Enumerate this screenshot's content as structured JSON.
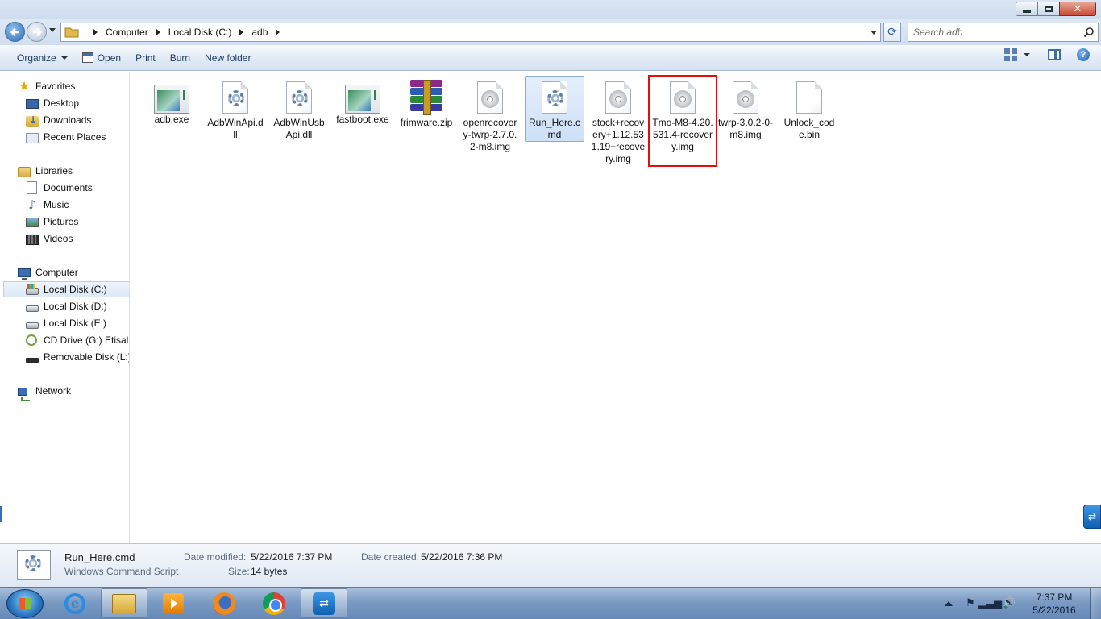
{
  "window": {
    "minimize": "minimize",
    "maximize": "maximize",
    "close": "close"
  },
  "address": {
    "crumbs": [
      "Computer",
      "Local Disk (C:)",
      "adb"
    ],
    "search_placeholder": "Search adb"
  },
  "commands": {
    "organize": "Organize",
    "open": "Open",
    "print": "Print",
    "burn": "Burn",
    "new_folder": "New folder"
  },
  "nav": {
    "favorites": "Favorites",
    "desktop": "Desktop",
    "downloads": "Downloads",
    "recent": "Recent Places",
    "libraries": "Libraries",
    "documents": "Documents",
    "music": "Music",
    "pictures": "Pictures",
    "videos": "Videos",
    "computer": "Computer",
    "disk_c": "Local Disk (C:)",
    "disk_d": "Local Disk (D:)",
    "disk_e": "Local Disk (E:)",
    "cd_drive": "CD Drive (G:) Etisalat",
    "removable": "Removable Disk (L:)",
    "network": "Network"
  },
  "files": [
    {
      "name": "adb.exe",
      "icon": "exe-icon"
    },
    {
      "name": "AdbWinApi.dll",
      "icon": "dll-icon"
    },
    {
      "name": "AdbWinUsbApi.dll",
      "icon": "dll-icon"
    },
    {
      "name": "fastboot.exe",
      "icon": "exe-icon"
    },
    {
      "name": "frimware.zip",
      "icon": "winrar-archive-icon"
    },
    {
      "name": "openrecovery-twrp-2.7.0.2-m8.img",
      "icon": "disc-image-icon"
    },
    {
      "name": "Run_Here.cmd",
      "icon": "cmd-script-icon"
    },
    {
      "name": "stock+recovery+1.12.531.19+recovery.img",
      "icon": "disc-image-icon"
    },
    {
      "name": "Tmo-M8-4.20.531.4-recovery.img",
      "icon": "disc-image-icon"
    },
    {
      "name": "twrp-3.0.2-0-m8.img",
      "icon": "disc-image-icon"
    },
    {
      "name": "Unlock_code.bin",
      "icon": "blank-file-icon"
    }
  ],
  "details": {
    "filename": "Run_Here.cmd",
    "filetype": "Windows Command Script",
    "modified_label": "Date modified:",
    "modified_value": "5/22/2016 7:37 PM",
    "created_label": "Date created:",
    "created_value": "5/22/2016 7:36 PM",
    "size_label": "Size:",
    "size_value": "14 bytes"
  },
  "taskbar": {
    "apps": [
      "internet-explorer",
      "windows-explorer",
      "media-player",
      "firefox",
      "chrome",
      "teamviewer"
    ],
    "time": "7:37 PM",
    "date": "5/22/2016"
  },
  "colors": {
    "highlight_box": "#e10e0e",
    "selection": "#cde0f7",
    "chrome": "#d1deef"
  }
}
